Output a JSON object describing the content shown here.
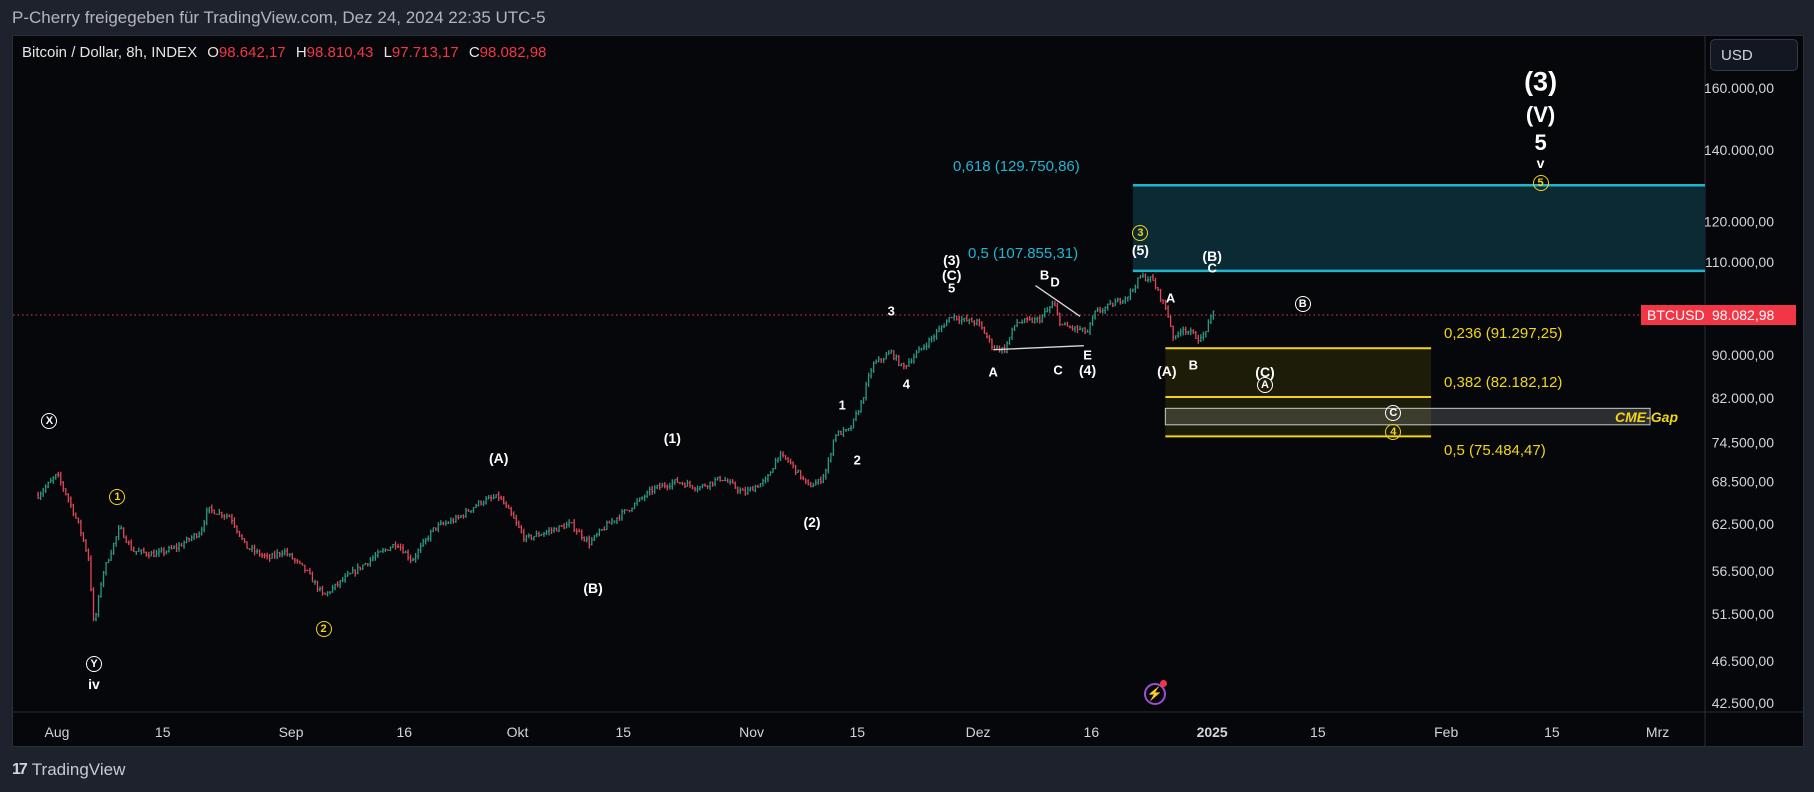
{
  "share_line": "P-Cherry freigegeben für TradingView.com, Dez 24, 2024 22:35 UTC-5",
  "footer": {
    "logo_glyph": "17",
    "brand": "TradingView"
  },
  "legend": {
    "symbol": "Bitcoin / Dollar, 8h, INDEX",
    "open_key": "O",
    "open": "98.642,17",
    "high_key": "H",
    "high": "98.810,43",
    "low_key": "L",
    "low": "97.713,17",
    "close_key": "C",
    "close": "98.082,98"
  },
  "currency_button": "USD",
  "price_tag": {
    "symbol": "BTCUSD",
    "price": "98.082,98"
  },
  "colors": {
    "up": "#2a9a85",
    "down": "#e0485a",
    "teal": "#22b5d0",
    "yellow": "#f0d617",
    "teal_fill": "#0b2a33",
    "yellow_fill": "#1d1c08",
    "last_price_line": "#f23645"
  },
  "chart_data": {
    "type": "candlestick",
    "title": "Bitcoin / Dollar, 8h, INDEX",
    "yscale": "log",
    "ylim": [
      41000,
      175000
    ],
    "y_ticks": [
      {
        "value": 160000,
        "label": "160.000,00"
      },
      {
        "value": 140000,
        "label": "140.000,00"
      },
      {
        "value": 120000,
        "label": "120.000,00"
      },
      {
        "value": 110000,
        "label": "110.000,00"
      },
      {
        "value": 90000,
        "label": "90.000,00"
      },
      {
        "value": 82000,
        "label": "82.000,00"
      },
      {
        "value": 74500,
        "label": "74.500,00"
      },
      {
        "value": 68500,
        "label": "68.500,00"
      },
      {
        "value": 62500,
        "label": "62.500,00"
      },
      {
        "value": 56500,
        "label": "56.500,00"
      },
      {
        "value": 51500,
        "label": "51.500,00"
      },
      {
        "value": 46500,
        "label": "46.500,00"
      },
      {
        "value": 42500,
        "label": "42.500,00"
      }
    ],
    "x_range_days": [
      -3,
      150
    ],
    "x_ticks": [
      {
        "day": 0,
        "label": "Aug",
        "bold": false
      },
      {
        "day": 14,
        "label": "15",
        "bold": false
      },
      {
        "day": 31,
        "label": "Sep",
        "bold": false
      },
      {
        "day": 46,
        "label": "16",
        "bold": false
      },
      {
        "day": 61,
        "label": "Okt",
        "bold": false
      },
      {
        "day": 75,
        "label": "15",
        "bold": false
      },
      {
        "day": 92,
        "label": "Nov",
        "bold": false
      },
      {
        "day": 106,
        "label": "15",
        "bold": false
      },
      {
        "day": 122,
        "label": "Dez",
        "bold": false
      },
      {
        "day": 137,
        "label": "16",
        "bold": false
      },
      {
        "day": 153,
        "label": "2025",
        "bold": true
      },
      {
        "day": 167,
        "label": "15",
        "bold": false
      },
      {
        "day": 184,
        "label": "Feb",
        "bold": false
      },
      {
        "day": 198,
        "label": "15",
        "bold": false
      },
      {
        "day": 212,
        "label": "Mrz",
        "bold": false
      }
    ],
    "price_path_note": "key swing points (day offset from Aug 1, price)",
    "price_path": [
      [
        -2.5,
        66500
      ],
      [
        0,
        69500
      ],
      [
        1.5,
        66000
      ],
      [
        3,
        62000
      ],
      [
        4.2,
        58000
      ],
      [
        4.9,
        50000
      ],
      [
        6,
        56000
      ],
      [
        8.3,
        62000
      ],
      [
        10,
        59000
      ],
      [
        13,
        58500
      ],
      [
        16,
        59500
      ],
      [
        19,
        61500
      ],
      [
        20,
        64500
      ],
      [
        23,
        63500
      ],
      [
        25,
        59500
      ],
      [
        28,
        58000
      ],
      [
        30,
        59000
      ],
      [
        33,
        56500
      ],
      [
        35.3,
        53500
      ],
      [
        38,
        55500
      ],
      [
        42,
        58200
      ],
      [
        45,
        60000
      ],
      [
        47,
        57800
      ],
      [
        50,
        62000
      ],
      [
        53,
        63200
      ],
      [
        56,
        65500
      ],
      [
        58.5,
        66300
      ],
      [
        60,
        64000
      ],
      [
        62,
        60500
      ],
      [
        65,
        61500
      ],
      [
        68,
        62500
      ],
      [
        70.5,
        60000
      ],
      [
        73,
        62500
      ],
      [
        76,
        64800
      ],
      [
        79,
        67400
      ],
      [
        82,
        68500
      ],
      [
        85,
        67600
      ],
      [
        88,
        69000
      ],
      [
        91,
        66800
      ],
      [
        94,
        68700
      ],
      [
        95.5,
        72500
      ],
      [
        97,
        71500
      ],
      [
        99.5,
        67800
      ],
      [
        101,
        68500
      ],
      [
        102,
        70500
      ],
      [
        103,
        75800
      ],
      [
        105,
        76500
      ],
      [
        106.5,
        81000
      ],
      [
        108,
        88000
      ],
      [
        110.5,
        90500
      ],
      [
        112,
        87500
      ],
      [
        114,
        90500
      ],
      [
        116,
        93500
      ],
      [
        118.5,
        98000
      ],
      [
        120,
        97000
      ],
      [
        122,
        96500
      ],
      [
        124,
        91500
      ],
      [
        125.5,
        91000
      ],
      [
        127,
        96500
      ],
      [
        130,
        97000
      ],
      [
        132,
        100500
      ],
      [
        133,
        96000
      ],
      [
        134,
        95500
      ],
      [
        135.5,
        95000
      ],
      [
        136.5,
        94500
      ],
      [
        137.5,
        98500
      ],
      [
        140,
        100500
      ],
      [
        142,
        102500
      ],
      [
        143.5,
        106500
      ],
      [
        145,
        106000
      ],
      [
        146,
        102500
      ],
      [
        147,
        99000
      ],
      [
        148,
        92800
      ],
      [
        149,
        95500
      ],
      [
        150.5,
        94000
      ],
      [
        151.5,
        93000
      ],
      [
        152.5,
        96000
      ],
      [
        153.2,
        98800
      ]
    ],
    "last_price": 98082.98,
    "fib_upper": {
      "levels": [
        {
          "ratio": "0,618",
          "value": 129750.86,
          "label": "0,618 (129.750,86)"
        },
        {
          "ratio": "0,5",
          "value": 107855.31,
          "label": "0,5 (107.855,31)"
        }
      ],
      "start_day": 142.5
    },
    "fib_lower": {
      "levels": [
        {
          "ratio": "0,236",
          "value": 91297.25,
          "label": "0,236 (91.297,25)"
        },
        {
          "ratio": "0,382",
          "value": 82182.12,
          "label": "0,382 (82.182,12)"
        },
        {
          "ratio": "0,5",
          "value": 75484.47,
          "label": "0,5 (75.484,47)"
        }
      ],
      "start_day": 146.8,
      "end_day": 182
    },
    "cme_gap": {
      "label": "CME-Gap",
      "top": 80200,
      "bottom": 77400,
      "start_day": 146.8,
      "end_day": 211
    },
    "triangle": {
      "upper": [
        [
          129.6,
          104500
        ],
        [
          135.5,
          97800
        ]
      ],
      "lower": [
        [
          124,
          91000
        ],
        [
          136,
          91800
        ]
      ]
    },
    "wave_labels": [
      {
        "text": "X",
        "style": "circle",
        "day": -1,
        "price": 78000
      },
      {
        "text": "Y",
        "style": "circle",
        "day": 4.9,
        "price": 46200
      },
      {
        "text": "iv",
        "style": "plain",
        "day": 4.9,
        "price": 44300
      },
      {
        "text": "1",
        "style": "circle-yellow",
        "day": 8,
        "price": 66200
      },
      {
        "text": "2",
        "style": "circle-yellow",
        "day": 35.3,
        "price": 49800
      },
      {
        "text": "(A)",
        "style": "plain",
        "day": 58.5,
        "price": 72000
      },
      {
        "text": "(B)",
        "style": "plain",
        "day": 71,
        "price": 54500
      },
      {
        "text": "(1)",
        "style": "plain",
        "day": 81.5,
        "price": 75200
      },
      {
        "text": "(2)",
        "style": "plain",
        "day": 100,
        "price": 62800
      },
      {
        "text": "1",
        "style": "plain-bold",
        "day": 104,
        "price": 80800
      },
      {
        "text": "2",
        "style": "plain-bold",
        "day": 106,
        "price": 71800
      },
      {
        "text": "3",
        "style": "plain-bold",
        "day": 110.5,
        "price": 99000
      },
      {
        "text": "4",
        "style": "plain-bold",
        "day": 112.5,
        "price": 84600
      },
      {
        "text": "(3)",
        "style": "plain",
        "day": 118.5,
        "price": 110500
      },
      {
        "text": "(C)",
        "style": "plain",
        "day": 118.5,
        "price": 107000
      },
      {
        "text": "5",
        "style": "plain-bold",
        "day": 118.5,
        "price": 104000
      },
      {
        "text": "A",
        "style": "plain-bold",
        "day": 124,
        "price": 86800
      },
      {
        "text": "B",
        "style": "plain-bold",
        "day": 130.8,
        "price": 106800
      },
      {
        "text": "D",
        "style": "plain-bold",
        "day": 132.2,
        "price": 105400
      },
      {
        "text": "C",
        "style": "plain-bold",
        "day": 132.6,
        "price": 87200
      },
      {
        "text": "E",
        "style": "plain-bold",
        "day": 136.5,
        "price": 90000
      },
      {
        "text": "(4)",
        "style": "plain",
        "day": 136.5,
        "price": 87200
      },
      {
        "text": "3",
        "style": "circle-yellow",
        "day": 143.5,
        "price": 117000
      },
      {
        "text": "(5)",
        "style": "plain",
        "day": 143.5,
        "price": 112800
      },
      {
        "text": "A",
        "style": "plain-bold",
        "day": 147.5,
        "price": 101700
      },
      {
        "text": "(A)",
        "style": "plain",
        "day": 147,
        "price": 87000
      },
      {
        "text": "B",
        "style": "plain-bold",
        "day": 150.5,
        "price": 88000
      },
      {
        "text": "(B)",
        "style": "plain",
        "day": 153,
        "price": 111500
      },
      {
        "text": "C",
        "style": "plain-bold",
        "day": 153,
        "price": 108500
      },
      {
        "text": "B",
        "style": "circle",
        "day": 165,
        "price": 100500
      },
      {
        "text": "(C)",
        "style": "plain",
        "day": 160,
        "price": 86800
      },
      {
        "text": "A",
        "style": "circle",
        "day": 160,
        "price": 84400
      },
      {
        "text": "C",
        "style": "circle",
        "day": 177,
        "price": 79400
      },
      {
        "text": "4",
        "style": "circle-yellow",
        "day": 177,
        "price": 76200
      },
      {
        "text": "(3)",
        "style": "plain-xl",
        "day": 196.5,
        "price": 162000
      },
      {
        "text": "(V)",
        "style": "plain-lg",
        "day": 196.5,
        "price": 151000
      },
      {
        "text": "5",
        "style": "plain-lg",
        "day": 196.5,
        "price": 142000
      },
      {
        "text": "v",
        "style": "plain",
        "day": 196.5,
        "price": 136000
      },
      {
        "text": "5",
        "style": "circle-yellow",
        "day": 196.5,
        "price": 130500
      }
    ]
  }
}
